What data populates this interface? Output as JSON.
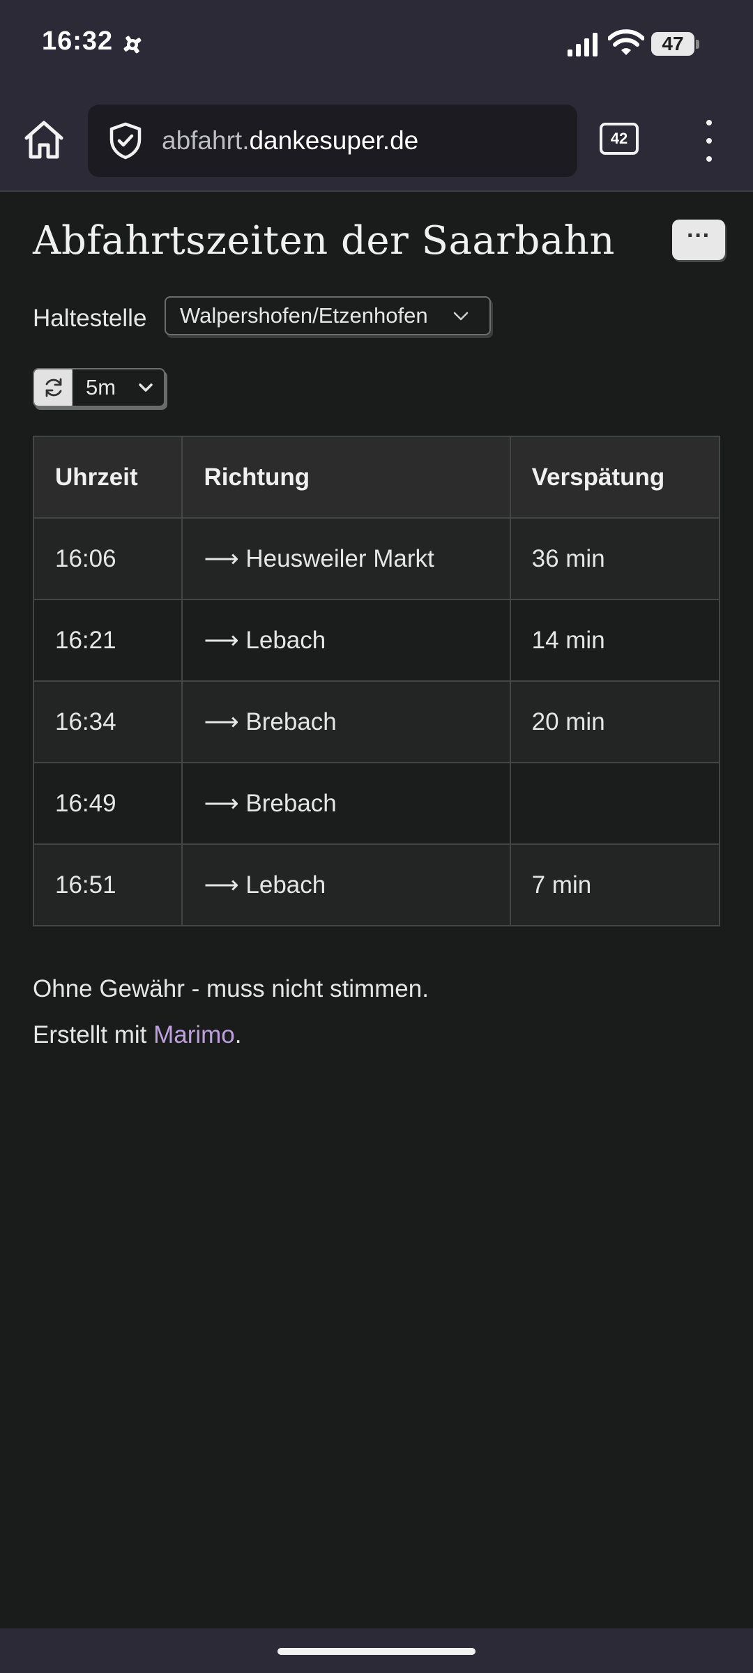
{
  "status_bar": {
    "time": "16:32",
    "battery_level": "47",
    "icons": [
      "gear-icon",
      "signal-icon",
      "wifi-icon",
      "battery-icon"
    ]
  },
  "browser": {
    "url_subdomain": "abfahrt.",
    "url_domain": "dankesuper.de",
    "tab_count": "42",
    "icons": [
      "home-icon",
      "shield-icon",
      "tabs-icon",
      "overflow-menu-icon"
    ]
  },
  "page": {
    "title": "Abfahrtszeiten der Saarbahn",
    "more_label": "···",
    "stop_label": "Haltestelle",
    "stop_value": "Walpershofen/Etzenhofen",
    "refresh_interval": "5m"
  },
  "table": {
    "headers": {
      "time": "Uhrzeit",
      "direction": "Richtung",
      "delay": "Verspätung"
    },
    "rows": [
      {
        "time": "16:06",
        "direction": "⟶ Heusweiler Markt",
        "delay": "36 min"
      },
      {
        "time": "16:21",
        "direction": "⟶ Lebach",
        "delay": "14 min"
      },
      {
        "time": "16:34",
        "direction": "⟶ Brebach",
        "delay": "20 min"
      },
      {
        "time": "16:49",
        "direction": "⟶ Brebach",
        "delay": ""
      },
      {
        "time": "16:51",
        "direction": "⟶ Lebach",
        "delay": "7 min"
      }
    ]
  },
  "footer": {
    "disclaimer": "Ohne Gewähr - muss nicht stimmen.",
    "credit_prefix": "Erstellt mit ",
    "credit_link": "Marimo",
    "credit_suffix": "."
  },
  "colors": {
    "status_bar_bg": "#2b2a36",
    "page_bg": "#1a1c1c",
    "link": "#c09fe0"
  }
}
